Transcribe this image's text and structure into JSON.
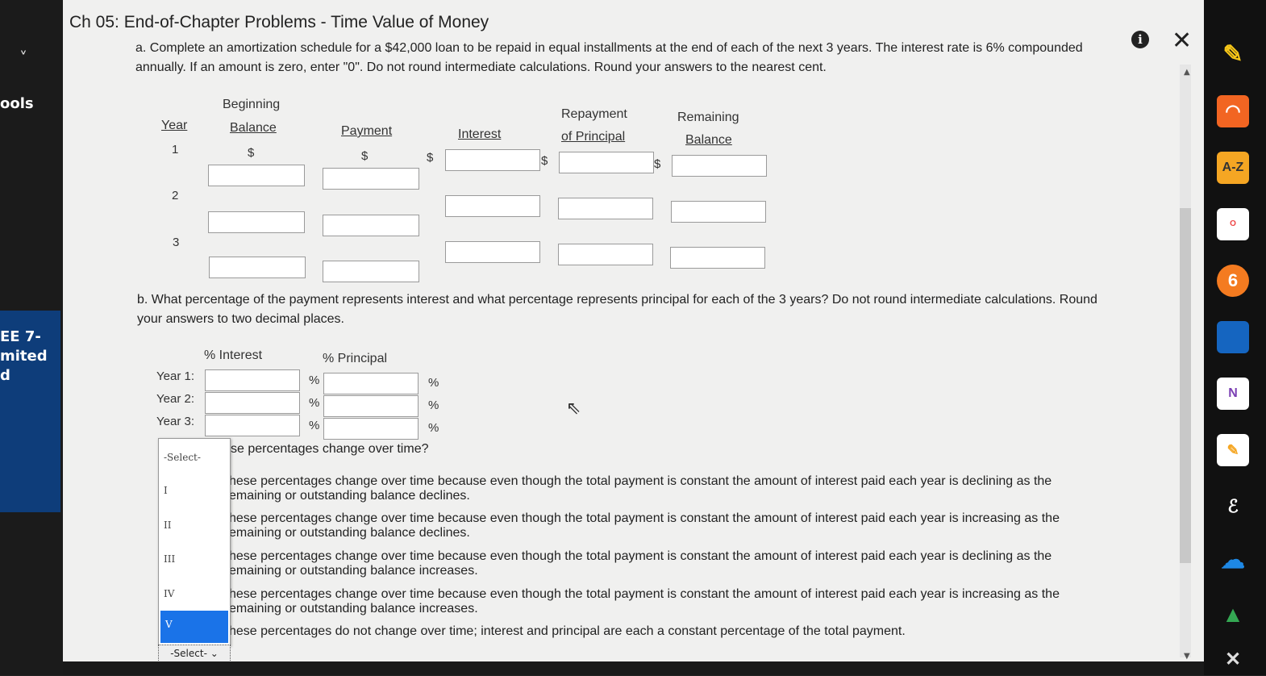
{
  "window": {
    "title": "Ch 05: End-of-Chapter Problems - Time Value of Money"
  },
  "left_nav": {
    "chevron": "˅",
    "tools_label": "ools",
    "assignment_lines": [
      "EE 7-",
      "mited",
      "d"
    ]
  },
  "part_a": {
    "text": "a. Complete an amortization schedule for a $42,000 loan to be repaid in equal installments at the end of each of the next 3 years. The interest rate is 6% compounded annually. If an amount is zero, enter \"0\". Do not round intermediate calculations. Round your answers to the nearest cent.",
    "headers": {
      "year": "Year",
      "beginning_1": "Beginning",
      "beginning_2": "Balance",
      "payment": "Payment",
      "interest": "Interest",
      "repayment_1": "Repayment",
      "repayment_2": "of Principal",
      "remaining_1": "Remaining",
      "remaining_2": "Balance"
    },
    "currency_symbol": "$",
    "years": [
      "1",
      "2",
      "3"
    ]
  },
  "part_b": {
    "text": "b. What percentage of the payment represents interest and what percentage represents principal for each of the 3 years? Do not round intermediate calculations. Round your answers to two decimal places.",
    "headers": {
      "interest": "% Interest",
      "principal": "% Principal"
    },
    "rows": [
      "Year 1:",
      "Year 2:",
      "Year 3:"
    ],
    "pct_symbol": "%"
  },
  "part_c": {
    "question_fragment": "se percentages change over time?",
    "options": [
      {
        "line1": "hese percentages change over time because even though the total payment is constant the amount of interest paid each year is declining as the",
        "line2": "emaining or outstanding balance declines."
      },
      {
        "line1": "hese percentages change over time because even though the total payment is constant the amount of interest paid each year is increasing as the",
        "line2": "emaining or outstanding balance declines."
      },
      {
        "line1": "hese percentages change over time because even though the total payment is constant the amount of interest paid each year is declining as the",
        "line2": "emaining or outstanding balance increases."
      },
      {
        "line1": "hese percentages change over time because even though the total payment is constant the amount of interest paid each year is increasing as the",
        "line2": "emaining or outstanding balance increases."
      },
      {
        "line1": "hese percentages do not change over time; interest and principal are each a constant percentage of the total payment.",
        "line2": ""
      }
    ],
    "dropdown": {
      "header": "-Select-",
      "items": [
        "I",
        "II",
        "III",
        "IV"
      ],
      "highlighted": "V",
      "current_value": "-Select-"
    }
  },
  "right_bar": {
    "az_label": "A-Z",
    "onenote_label": "N"
  },
  "colors": {
    "panel_bg": "#f0f0ef",
    "highlight": "#1a73e8",
    "left_blue": "#0e3d7a"
  }
}
